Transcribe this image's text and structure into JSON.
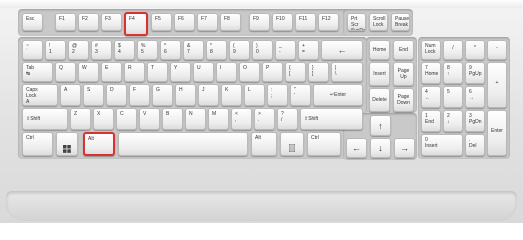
{
  "keyboard": {
    "highlight_color": "#d9322f",
    "highlighted_keys": [
      "F4",
      "Alt"
    ],
    "f_row": {
      "esc": "Esc",
      "f1": "F1",
      "f2": "F2",
      "f3": "F3",
      "f4": "F4",
      "f5": "F5",
      "f6": "F6",
      "f7": "F7",
      "f8": "F8",
      "f9": "F9",
      "f10": "F10",
      "f11": "F11",
      "f12": "F12",
      "prtsc": "Prt Scr\nSysRq",
      "scroll": "Scroll\nLock",
      "pause": "Pause\nBreak"
    },
    "number_row": {
      "backtick": "~\n`",
      "k1": "!\n1",
      "k2": "@\n2",
      "k3": "#\n3",
      "k4": "$\n4",
      "k5": "%\n5",
      "k6": "^\n6",
      "k7": "&\n7",
      "k8": "*\n8",
      "k9": "(\n9",
      "k0": ")\n0",
      "minus": "_\n-",
      "equals": "+\n=",
      "backspace": "←"
    },
    "tab_row": {
      "tab": "Tab\n↹",
      "q": "Q",
      "w": "W",
      "e": "E",
      "r": "R",
      "t": "T",
      "y": "Y",
      "u": "U",
      "i": "I",
      "o": "O",
      "p": "P",
      "lbracket": "{\n[",
      "rbracket": "}\n]",
      "backslash": "|\n\\"
    },
    "caps_row": {
      "caps": "Caps\nLock\nA",
      "a": "A",
      "s": "S",
      "d": "D",
      "f": "F",
      "g": "G",
      "h": "H",
      "j": "J",
      "k": "K",
      "l": "L",
      "semicolon": ":\n;",
      "quote": "\"\n'",
      "enter": "↵Enter"
    },
    "shift_row": {
      "lshift": "⇧Shift",
      "z": "Z",
      "x": "X",
      "c": "C",
      "v": "V",
      "b": "B",
      "n": "N",
      "m": "M",
      "comma": "<\n,",
      "period": ">\n.",
      "slash": "?\n/",
      "rshift": "⇧Shift"
    },
    "bottom_row": {
      "lctrl": "Ctrl",
      "lalt": "Alt",
      "space": "",
      "ralt": "Alt",
      "rctrl": "Ctrl"
    },
    "nav": {
      "home": "Home",
      "end": "End",
      "insert": "Insert",
      "pgup": "Page\nUp",
      "delete": "Delete",
      "pgdn": "Page\nDown",
      "up": "↑",
      "left": "←",
      "down": "↓",
      "right": "→"
    },
    "numpad": {
      "numlock": "Num\nLock",
      "div": "/",
      "mul": "*",
      "sub": "-",
      "n7": "7\nHome",
      "n8": "8\n↑",
      "n9": "9\nPgUp",
      "add": "+",
      "n4": "4\n←",
      "n5": "5",
      "n6": "6\n→",
      "n1": "1\nEnd",
      "n2": "2\n↓",
      "n3": "3\nPgDn",
      "enter": "Enter",
      "n0": "0\nInsert",
      "dec": ".\nDel"
    }
  }
}
